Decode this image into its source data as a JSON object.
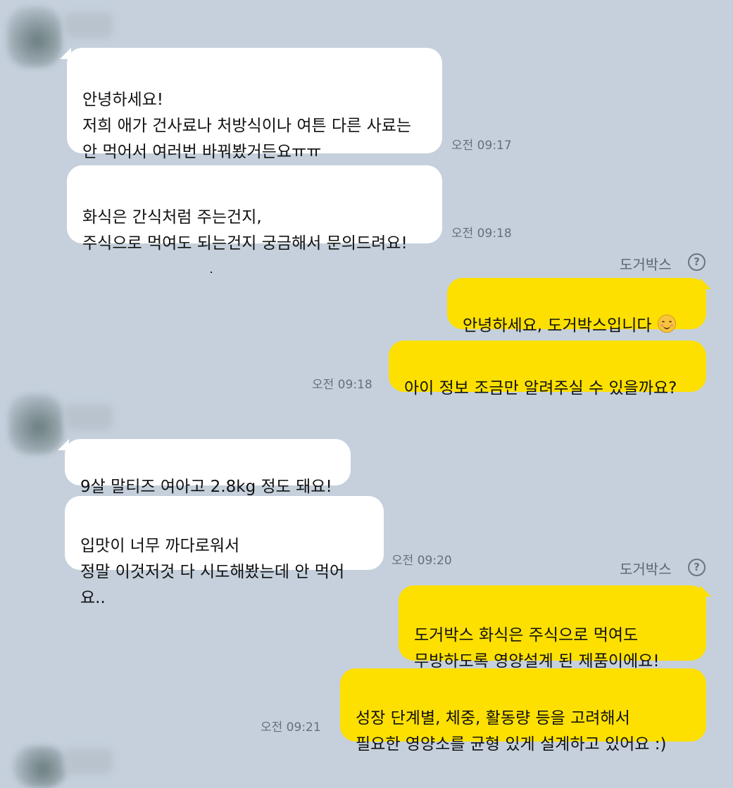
{
  "messages": {
    "m1": "안녕하세요!\n저희 애가 건사료나 처방식이나 여튼 다른 사료는\n안 먹어서 여러번 바꿔봤거든요ㅠㅠ",
    "m2": "화식은 간식처럼 주는건지,\n주식으로 먹여도 되는건지 궁금해서 문의드려요!",
    "m3": "안녕하세요, 도거박스입니다",
    "m4": "아이 정보 조금만 알려주실 수 있을까요?",
    "m5": "9살 말티즈 여아고 2.8kg 정도 돼요!",
    "m6": "입맛이 너무 까다로워서\n정말 이것저것 다 시도해봤는데 안 먹어요..",
    "m7": "도거박스 화식은 주식으로 먹여도\n무방하도록 영양설계 된 제품이에요!",
    "m8": "성장 단계별, 체중, 활동량 등을 고려해서\n필요한 영양소를 균형 있게 설계하고 있어요 :)"
  },
  "times": {
    "t1": "오전 09:17",
    "t2": "오전 09:18",
    "t3": "오전 09:18",
    "t4": "오전 09:20",
    "t5": "오전 09:21"
  },
  "sender": {
    "name": "도거박스",
    "help_symbol": "?"
  },
  "icons": {
    "emoji": "smiling-face-emoji-icon",
    "help": "question-circle-icon"
  },
  "colors": {
    "background": "#c5d0dc",
    "incoming_bubble": "#ffffff",
    "outgoing_bubble": "#fde000"
  }
}
